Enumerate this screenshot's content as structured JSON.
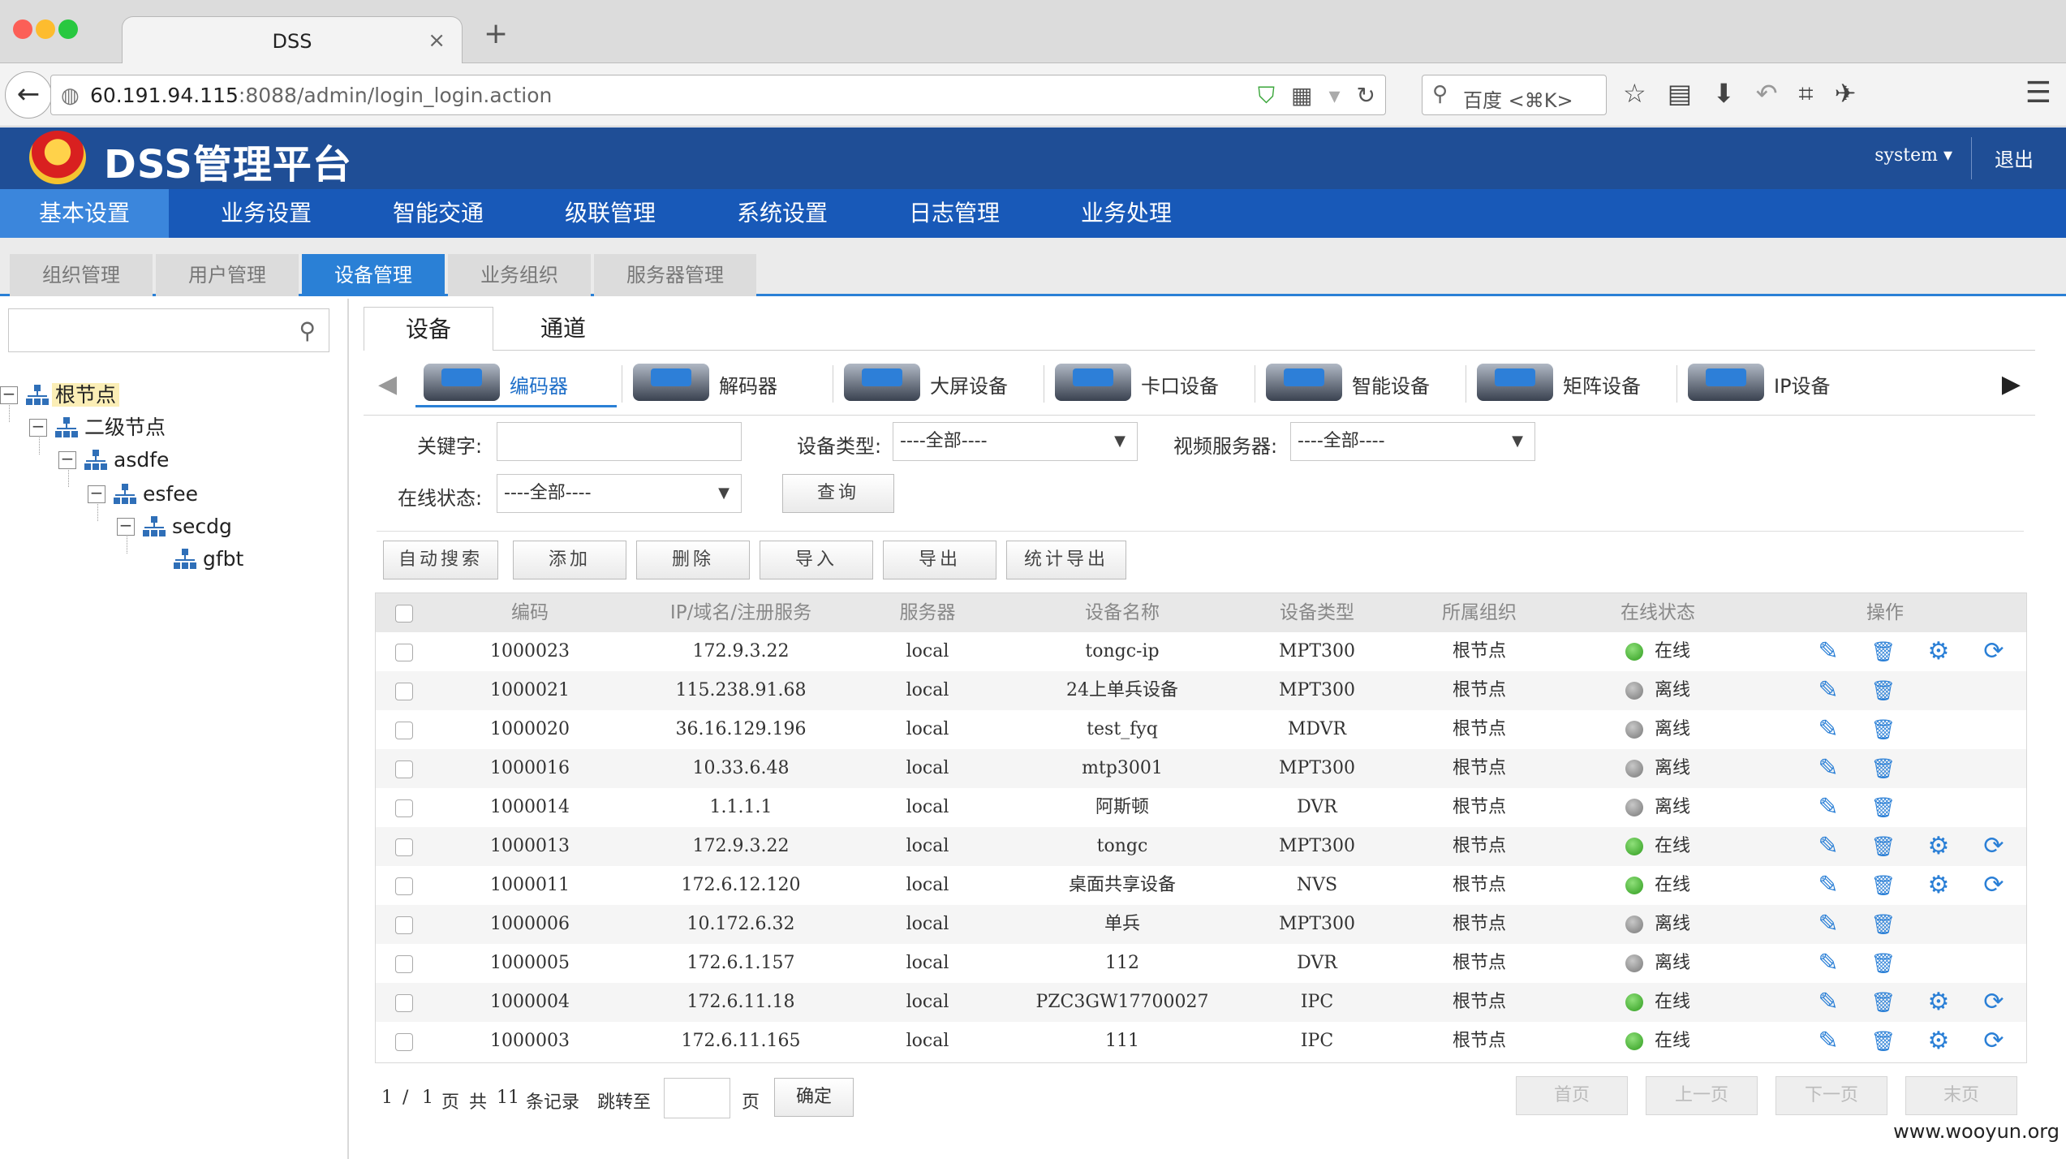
{
  "browser": {
    "tab_title": "DSS",
    "url_host": "60.191.94.115",
    "url_rest": ":8088/admin/login_login.action",
    "search_placeholder": "百度 <⌘K>"
  },
  "header": {
    "title": "DSS管理平台",
    "user": "system",
    "logout": "退出"
  },
  "main_nav": [
    {
      "label": "基本设置",
      "active": true
    },
    {
      "label": "业务设置"
    },
    {
      "label": "智能交通"
    },
    {
      "label": "级联管理"
    },
    {
      "label": "系统设置"
    },
    {
      "label": "日志管理"
    },
    {
      "label": "业务处理"
    }
  ],
  "sub_nav": [
    {
      "label": "组织管理"
    },
    {
      "label": "用户管理"
    },
    {
      "label": "设备管理",
      "active": true
    },
    {
      "label": "业务组织"
    },
    {
      "label": "服务器管理"
    }
  ],
  "tree": [
    {
      "label": "根节点",
      "level": 0,
      "selected": true
    },
    {
      "label": "二级节点",
      "level": 1
    },
    {
      "label": "asdfe",
      "level": 2
    },
    {
      "label": "esfee",
      "level": 3
    },
    {
      "label": "secdg",
      "level": 4
    },
    {
      "label": "gfbt",
      "level": 5
    }
  ],
  "panel_tabs": [
    {
      "label": "设备",
      "active": true
    },
    {
      "label": "通道"
    }
  ],
  "device_types": [
    {
      "label": "编码器",
      "active": true
    },
    {
      "label": "解码器"
    },
    {
      "label": "大屏设备"
    },
    {
      "label": "卡口设备"
    },
    {
      "label": "智能设备"
    },
    {
      "label": "矩阵设备"
    },
    {
      "label": "IP设备"
    }
  ],
  "filters": {
    "keyword_label": "关键字:",
    "keyword_value": "",
    "device_type_label": "设备类型:",
    "device_type_value": "----全部----",
    "video_server_label": "视频服务器:",
    "video_server_value": "----全部----",
    "online_label": "在线状态:",
    "online_value": "----全部----",
    "query_button": "查询"
  },
  "actions": [
    "自动搜索",
    "添加",
    "删除",
    "导入",
    "导出",
    "统计导出"
  ],
  "table": {
    "columns": [
      "编码",
      "IP/域名/注册服务",
      "服务器",
      "设备名称",
      "设备类型",
      "所属组织",
      "在线状态",
      "操作"
    ],
    "rows": [
      {
        "code": "1000023",
        "ip": "172.9.3.22",
        "server": "local",
        "name": "tongc-ip",
        "type": "MPT300",
        "org": "根节点",
        "status": "在线",
        "online": true
      },
      {
        "code": "1000021",
        "ip": "115.238.91.68",
        "server": "local",
        "name": "24上单兵设备",
        "type": "MPT300",
        "org": "根节点",
        "status": "离线",
        "online": false
      },
      {
        "code": "1000020",
        "ip": "36.16.129.196",
        "server": "local",
        "name": "test_fyq",
        "type": "MDVR",
        "org": "根节点",
        "status": "离线",
        "online": false
      },
      {
        "code": "1000016",
        "ip": "10.33.6.48",
        "server": "local",
        "name": "mtp3001",
        "type": "MPT300",
        "org": "根节点",
        "status": "离线",
        "online": false
      },
      {
        "code": "1000014",
        "ip": "1.1.1.1",
        "server": "local",
        "name": "阿斯顿",
        "type": "DVR",
        "org": "根节点",
        "status": "离线",
        "online": false
      },
      {
        "code": "1000013",
        "ip": "172.9.3.22",
        "server": "local",
        "name": "tongc",
        "type": "MPT300",
        "org": "根节点",
        "status": "在线",
        "online": true
      },
      {
        "code": "1000011",
        "ip": "172.6.12.120",
        "server": "local",
        "name": "桌面共享设备",
        "type": "NVS",
        "org": "根节点",
        "status": "在线",
        "online": true
      },
      {
        "code": "1000006",
        "ip": "10.172.6.32",
        "server": "local",
        "name": "单兵",
        "type": "MPT300",
        "org": "根节点",
        "status": "离线",
        "online": false
      },
      {
        "code": "1000005",
        "ip": "172.6.1.157",
        "server": "local",
        "name": "112",
        "type": "DVR",
        "org": "根节点",
        "status": "离线",
        "online": false
      },
      {
        "code": "1000004",
        "ip": "172.6.11.18",
        "server": "local",
        "name": "PZC3GW17700027",
        "type": "IPC",
        "org": "根节点",
        "status": "在线",
        "online": true
      },
      {
        "code": "1000003",
        "ip": "172.6.11.165",
        "server": "local",
        "name": "111",
        "type": "IPC",
        "org": "根节点",
        "status": "在线",
        "online": true
      }
    ]
  },
  "pager": {
    "current": "1",
    "slash": "/",
    "total_pages": "1",
    "page_word": "页",
    "total_word": "共",
    "records": "11",
    "records_word": "条记录",
    "jump_word": "跳转至",
    "confirm": "确定",
    "first": "首页",
    "prev": "上一页",
    "next": "下一页",
    "last": "末页"
  },
  "watermark": "www.wooyun.org"
}
